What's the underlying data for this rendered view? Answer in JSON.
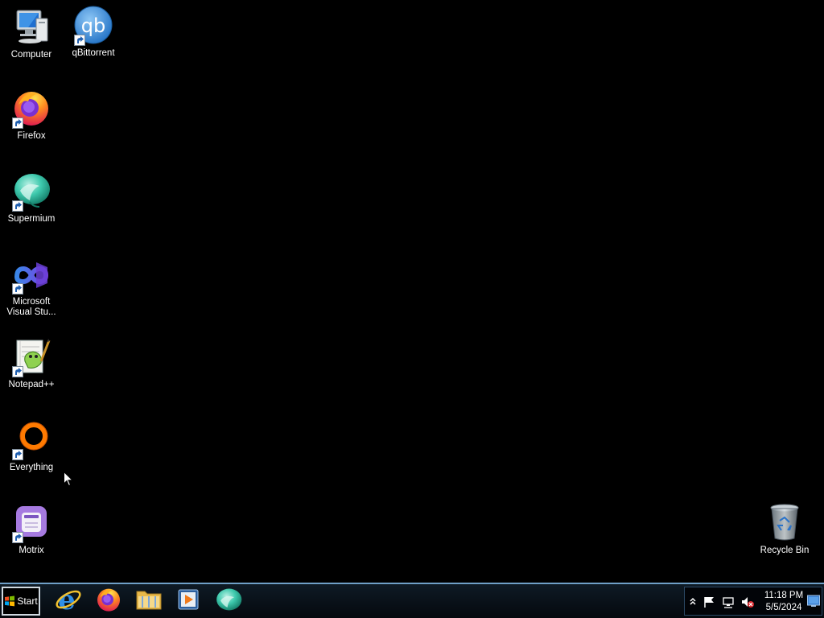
{
  "desktop": {
    "icons": [
      {
        "label": "Computer",
        "icon": "computer-icon"
      },
      {
        "label": "qBittorrent",
        "icon": "qbittorrent-icon"
      },
      {
        "label": "Firefox",
        "icon": "firefox-icon"
      },
      {
        "label": "Supermium",
        "icon": "supermium-icon"
      },
      {
        "label": "Microsoft\nVisual Stu...",
        "icon": "visual-studio-icon"
      },
      {
        "label": "Notepad++",
        "icon": "notepadpp-icon"
      },
      {
        "label": "Everything",
        "icon": "everything-icon"
      },
      {
        "label": "Motrix",
        "icon": "motrix-icon"
      },
      {
        "label": "Recycle Bin",
        "icon": "recycle-bin-icon"
      }
    ],
    "qb_glyph": "qb"
  },
  "taskbar": {
    "start_label": "Start",
    "pinned": [
      "internet-explorer-icon",
      "firefox-icon",
      "file-explorer-icon",
      "media-player-icon",
      "supermium-icon"
    ],
    "tray": {
      "clock_time": "11:18 PM",
      "clock_date": "5/5/2024"
    }
  },
  "colors": {
    "desktop_bg": "#000000",
    "taskbar_border": "#6fa0c8"
  }
}
